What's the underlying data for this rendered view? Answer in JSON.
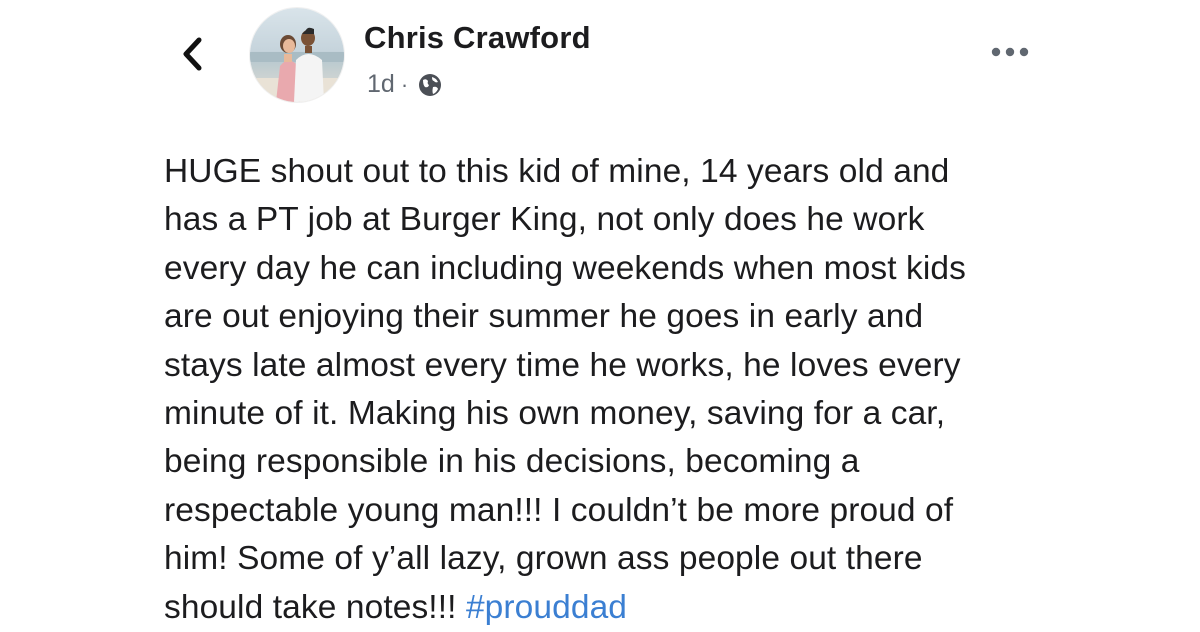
{
  "header": {
    "back_icon": "chevron-left-icon",
    "author_name": "Chris Crawford",
    "timestamp": "1d",
    "separator": "·",
    "audience_icon": "globe-icon",
    "more_icon": "more-horizontal-icon"
  },
  "post": {
    "lines": [
      "HUGE shout out to this kid of mine, 14 years old and",
      "has a PT job at Burger King, not only does he work",
      "every day he can including weekends when most kids",
      "are out enjoying their summer he goes in early and",
      "stays late almost every time he works, he loves every",
      "minute of it. Making his own money, saving for a car,",
      "being responsible in his decisions, becoming a",
      "respectable young man!!! I couldn’t be more proud of",
      "him! Some of y’all lazy, grown ass people out there",
      "should take notes!!! "
    ],
    "hashtag": "#prouddad"
  },
  "colors": {
    "text": "#1c1c1e",
    "meta": "#606770",
    "hashtag": "#3b7fd2",
    "icon": "#4b4f56"
  }
}
